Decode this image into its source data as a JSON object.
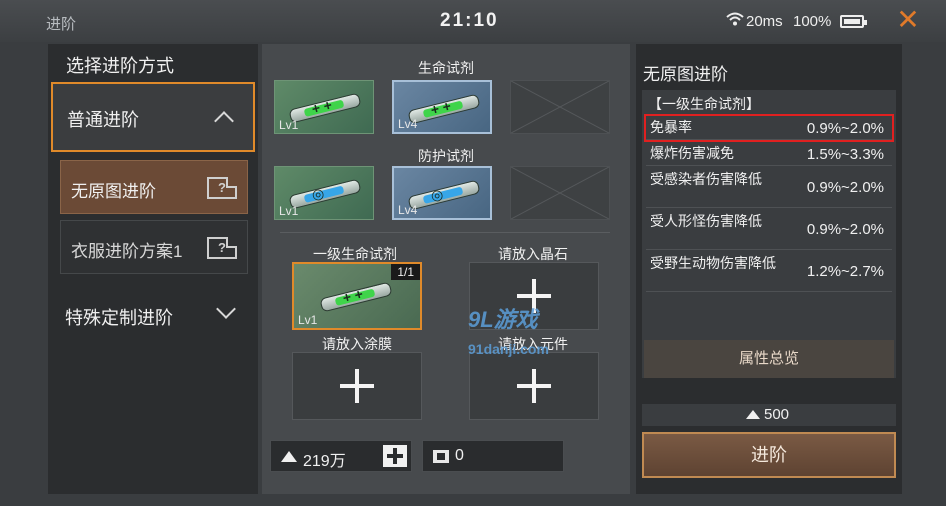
{
  "statusbar": {
    "title": "进阶",
    "clock": "21:10",
    "wifi_icon": "wifi-icon",
    "ping": "20ms",
    "battery": "100%"
  },
  "left_panel": {
    "heading": "选择进阶方式",
    "normal_mode": "普通进阶",
    "sub_items": [
      {
        "label": "无原图进阶",
        "active": true
      },
      {
        "label": "衣服进阶方案1",
        "active": false
      }
    ],
    "custom_mode": "特殊定制进阶"
  },
  "center_panel": {
    "groups": [
      {
        "title": "生命试剂",
        "slots": [
          {
            "level": "Lv1",
            "color": "green"
          },
          {
            "level": "Lv4",
            "color": "green",
            "selected": true
          },
          {
            "level": "",
            "empty": true
          }
        ]
      },
      {
        "title": "防护试剂",
        "slots": [
          {
            "level": "Lv1",
            "color": "blue"
          },
          {
            "level": "Lv4",
            "color": "blue",
            "selected": true
          },
          {
            "level": "",
            "empty": true
          }
        ]
      }
    ],
    "craft": {
      "main": {
        "label": "一级生命试剂",
        "level": "Lv1",
        "count": "1/1"
      },
      "crystal": {
        "label": "请放入晶石"
      },
      "coating": {
        "label": "请放入涂膜"
      },
      "component": {
        "label": "请放入元件"
      }
    },
    "watermark": {
      "brand": "9L游戏",
      "url": "91danji.com"
    },
    "currency": "219万",
    "chips": "0"
  },
  "right_panel": {
    "title": "无原图进阶",
    "group": "【一级生命试剂】",
    "attributes": [
      {
        "name": "免暴率",
        "value": "0.9%~2.0%",
        "highlight": true
      },
      {
        "name": "爆炸伤害减免",
        "value": "1.5%~3.3%"
      },
      {
        "name": "受感染者伤害降低",
        "value": "0.9%~2.0%"
      },
      {
        "name": "受人形怪伤害降低",
        "value": "0.9%~2.0%"
      },
      {
        "name": "受野生动物伤害降低",
        "value": "1.2%~2.7%"
      }
    ],
    "summary_button": "属性总览",
    "cost": "500",
    "advance_button": "进阶"
  },
  "colors": {
    "accent": "#e08a2a",
    "highlight": "#e02020",
    "panel": "#2b2d2f"
  }
}
